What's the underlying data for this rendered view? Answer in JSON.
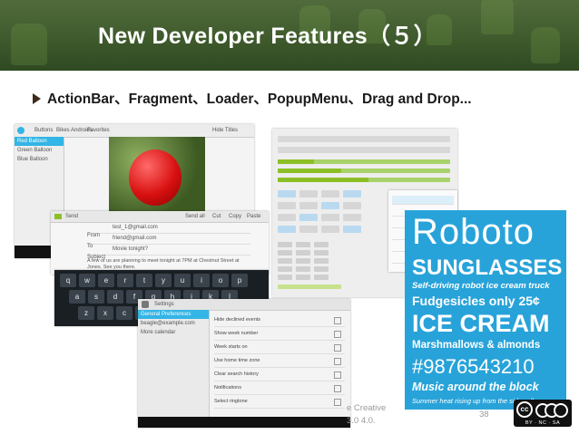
{
  "slide": {
    "title": "New Developer Features（５）",
    "bullet": "ActionBar、Fragment、Loader、PopupMenu、Drag and Drop...",
    "page_number": "38",
    "footer_text_1": "e Creative",
    "footer_text_2": "3.0 4.0.",
    "license_badge": {
      "cc": "cc",
      "by": "BY",
      "nc": "NC",
      "sa": "SA"
    }
  },
  "gallery_screenshot": {
    "tabs": [
      "Buttons",
      "Bikes",
      "Androids",
      "Favorites"
    ],
    "side_items": [
      "Red Balloon",
      "Green Balloon",
      "Blue Balloon"
    ],
    "hide_titles": "Hide Titles"
  },
  "email_screenshot": {
    "action": "Send",
    "menu": [
      "Send all",
      "Cut",
      "Copy",
      "Paste"
    ],
    "fields": [
      {
        "label": "From",
        "value": "test_1@gmail.com"
      },
      {
        "label": "To",
        "value": "friend@gmail.com"
      },
      {
        "label": "Subject",
        "value": "Movie tonight?"
      }
    ],
    "body": "A few of us are planning to meet tonight at 7PM at Chestnut Street at Jones. See you there."
  },
  "keyboard": {
    "rows": [
      [
        "q",
        "w",
        "e",
        "r",
        "t",
        "y",
        "u",
        "i",
        "o",
        "p"
      ],
      [
        "a",
        "s",
        "d",
        "f",
        "g",
        "h",
        "j",
        "k",
        "l"
      ],
      [
        "z",
        "x",
        "c",
        "v",
        "b",
        "n",
        "m"
      ]
    ]
  },
  "settings_screenshot": {
    "title": "Settings",
    "left_items": [
      "General Preferences",
      "beagle@example.com",
      "More calendar"
    ],
    "right_items": [
      "Hide declined events",
      "Show week number",
      "Week starts on",
      "Use home time zone",
      "Clear search history",
      "Notifications",
      "Select ringtone"
    ]
  },
  "roboto": {
    "lines": [
      "Roboto",
      "SUNGLASSES",
      "Self-driving robot ice cream truck",
      "Fudgesicles only 25¢",
      "ICE CREAM",
      "Marshmallows & almonds",
      "#9876543210",
      "Music around the block",
      "Summer heat rising up from the sidewalk"
    ]
  },
  "colors": {
    "header": "#3f5a2c",
    "holo_green": "#99cc00",
    "roboto_bg": "#28a3d9",
    "holo_blue": "#33b5e5"
  }
}
